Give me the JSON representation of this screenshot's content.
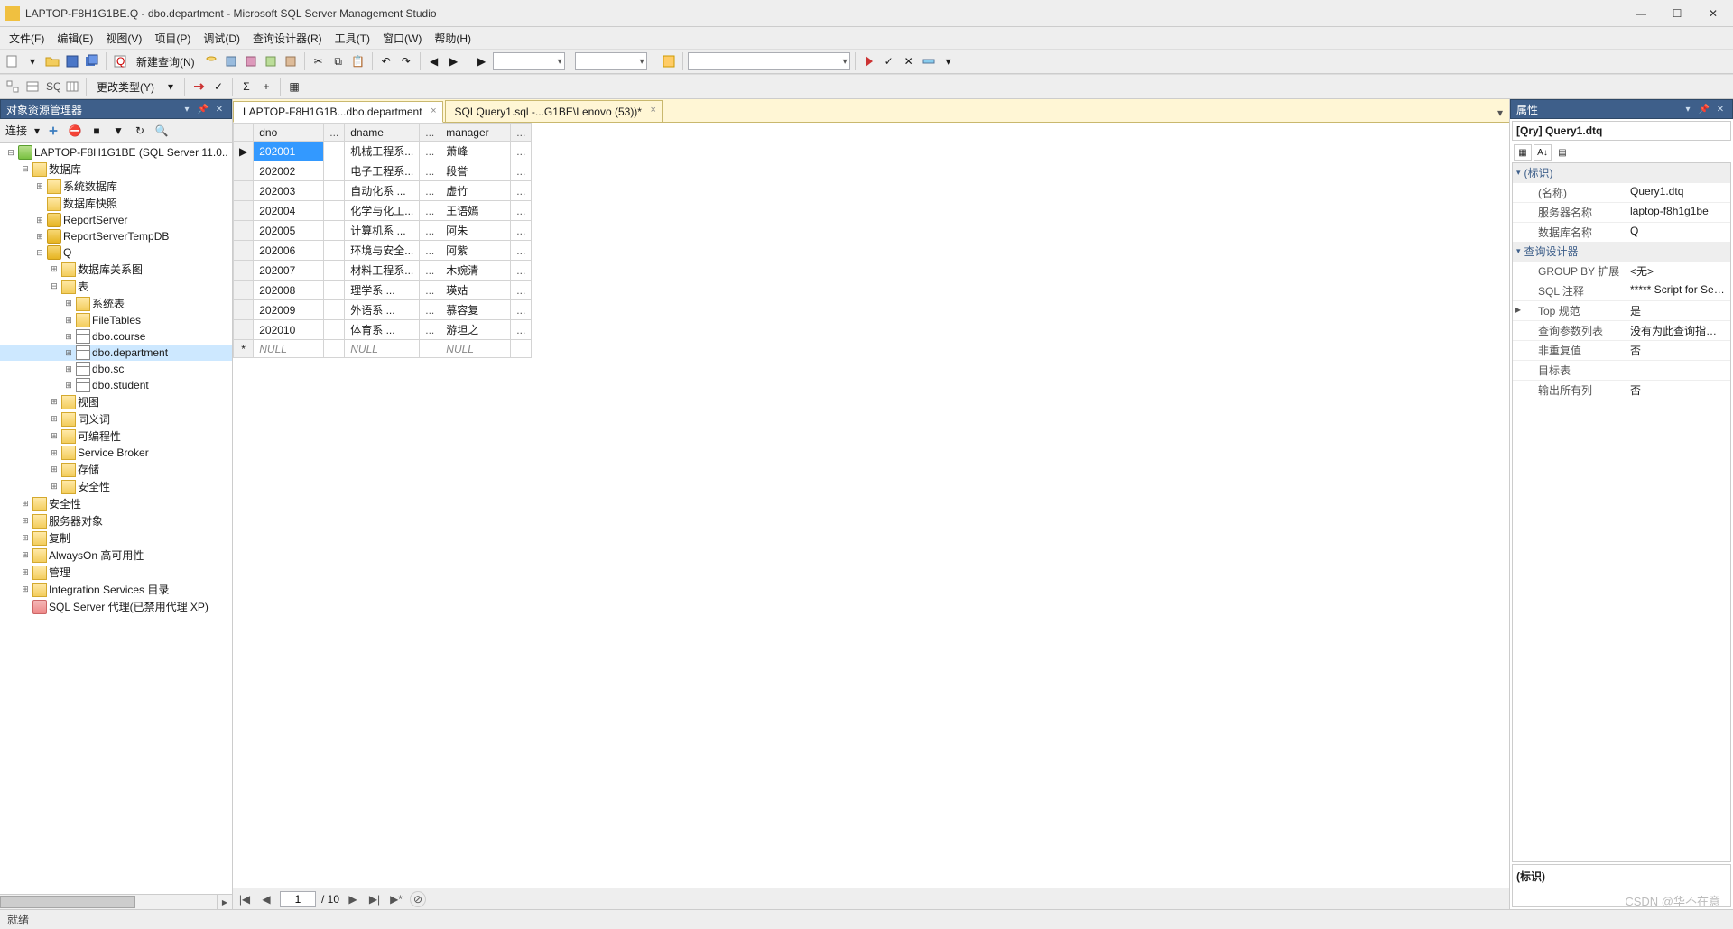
{
  "title": "LAPTOP-F8H1G1BE.Q - dbo.department - Microsoft SQL Server Management Studio",
  "menu": [
    "文件(F)",
    "编辑(E)",
    "视图(V)",
    "项目(P)",
    "调试(D)",
    "查询设计器(R)",
    "工具(T)",
    "窗口(W)",
    "帮助(H)"
  ],
  "toolbar2": {
    "change_type": "更改类型(Y)",
    "new_query": "新建查询(N)"
  },
  "objexp": {
    "title": "对象资源管理器",
    "connect": "连接",
    "root": "LAPTOP-F8H1G1BE (SQL Server 11.0..",
    "nodes": {
      "databases": "数据库",
      "sys_db": "系统数据库",
      "db_snapshot": "数据库快照",
      "rs": "ReportServer",
      "rstmp": "ReportServerTempDB",
      "q": "Q",
      "diagrams": "数据库关系图",
      "tables": "表",
      "sys_tables": "系统表",
      "filetables": "FileTables",
      "t_course": "dbo.course",
      "t_department": "dbo.department",
      "t_sc": "dbo.sc",
      "t_student": "dbo.student",
      "views": "视图",
      "synonyms": "同义词",
      "programmability": "可编程性",
      "service_broker": "Service Broker",
      "storage": "存储",
      "security_db": "安全性",
      "security": "安全性",
      "server_objects": "服务器对象",
      "replication": "复制",
      "alwayson": "AlwaysOn 高可用性",
      "management": "管理",
      "is_catalog": "Integration Services 目录",
      "agent": "SQL Server 代理(已禁用代理 XP)"
    }
  },
  "tabs": [
    {
      "label": "LAPTOP-F8H1G1B...dbo.department",
      "active": true
    },
    {
      "label": "SQLQuery1.sql -...G1BE\\Lenovo (53))*",
      "active": false
    }
  ],
  "grid": {
    "columns": [
      "dno",
      "dname",
      "manager"
    ],
    "rows": [
      {
        "dno": "202001",
        "dname": "机械工程系...",
        "manager": "萧峰",
        "selected": true
      },
      {
        "dno": "202002",
        "dname": "电子工程系...",
        "manager": "段誉"
      },
      {
        "dno": "202003",
        "dname": "自动化系   ...",
        "manager": "虚竹"
      },
      {
        "dno": "202004",
        "dname": "化学与化工...",
        "manager": "王语嫣"
      },
      {
        "dno": "202005",
        "dname": "计算机系   ...",
        "manager": "阿朱"
      },
      {
        "dno": "202006",
        "dname": "环境与安全...",
        "manager": "阿紫"
      },
      {
        "dno": "202007",
        "dname": "材料工程系...",
        "manager": "木婉清"
      },
      {
        "dno": "202008",
        "dname": "理学系     ...",
        "manager": "瑛姑"
      },
      {
        "dno": "202009",
        "dname": "外语系     ...",
        "manager": "慕容复"
      },
      {
        "dno": "202010",
        "dname": "体育系     ...",
        "manager": "游坦之"
      }
    ],
    "null_label": "NULL",
    "nav": {
      "pos": "1",
      "total": "/ 10"
    }
  },
  "props": {
    "title": "属性",
    "selector": "[Qry] Query1.dtq",
    "cats": [
      {
        "name": "(标识)",
        "items": [
          {
            "k": "(名称)",
            "v": "Query1.dtq"
          },
          {
            "k": "服务器名称",
            "v": "laptop-f8h1g1be"
          },
          {
            "k": "数据库名称",
            "v": "Q"
          }
        ]
      },
      {
        "name": "查询设计器",
        "items": [
          {
            "k": "GROUP BY 扩展",
            "v": "<无>"
          },
          {
            "k": "SQL 注释",
            "v": "***** Script for Select"
          },
          {
            "k": "Top 规范",
            "v": "是",
            "expandable": true
          },
          {
            "k": "查询参数列表",
            "v": "没有为此查询指定参数"
          },
          {
            "k": "非重复值",
            "v": "否"
          },
          {
            "k": "目标表",
            "v": ""
          },
          {
            "k": "输出所有列",
            "v": "否"
          }
        ]
      }
    ],
    "desc_title": "(标识)"
  },
  "status": "就绪",
  "watermark": "CSDN @华不在意"
}
